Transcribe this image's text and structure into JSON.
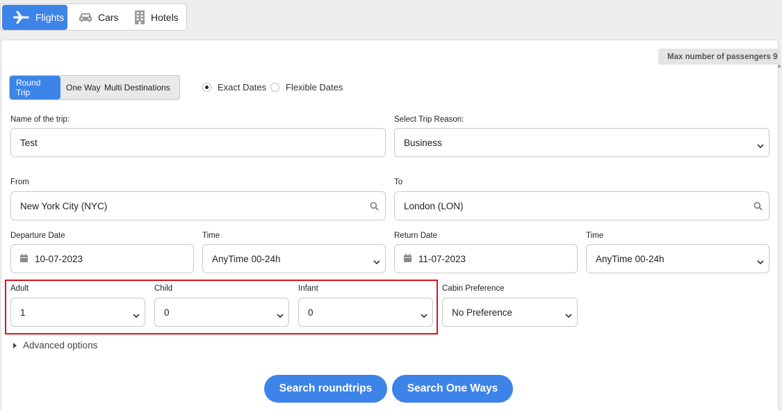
{
  "tabs": [
    {
      "label": "Flights",
      "icon": "plane-icon"
    },
    {
      "label": "Cars",
      "icon": "car-icon"
    },
    {
      "label": "Hotels",
      "icon": "building-icon"
    }
  ],
  "max_passengers": "Max number of passengers 9",
  "trip_types": [
    "Round Trip",
    "One Way",
    "Multi Destinations"
  ],
  "date_modes": [
    "Exact Dates",
    "Flexible Dates"
  ],
  "trip_name": {
    "label": "Name of the trip:",
    "value": "Test"
  },
  "trip_reason": {
    "label": "Select Trip Reason:",
    "value": "Business"
  },
  "from": {
    "label": "From",
    "value": "New York City (NYC)"
  },
  "to": {
    "label": "To",
    "value": "London (LON)"
  },
  "departure": {
    "label": "Departure Date",
    "value": "10-07-2023"
  },
  "departure_time": {
    "label": "Time",
    "value": "AnyTime 00-24h"
  },
  "return": {
    "label": "Return Date",
    "value": "11-07-2023"
  },
  "return_time": {
    "label": "Time",
    "value": "AnyTime 00-24h"
  },
  "adult": {
    "label": "Adult",
    "value": "1"
  },
  "child": {
    "label": "Child",
    "value": "0"
  },
  "infant": {
    "label": "Infant",
    "value": "0"
  },
  "cabin": {
    "label": "Cabin Preference",
    "value": "No Preference"
  },
  "advanced": "Advanced options",
  "buttons": {
    "roundtrips": "Search roundtrips",
    "oneways": "Search One Ways"
  },
  "colors": {
    "accent": "#3d84e8",
    "highlight": "#d9141d"
  }
}
